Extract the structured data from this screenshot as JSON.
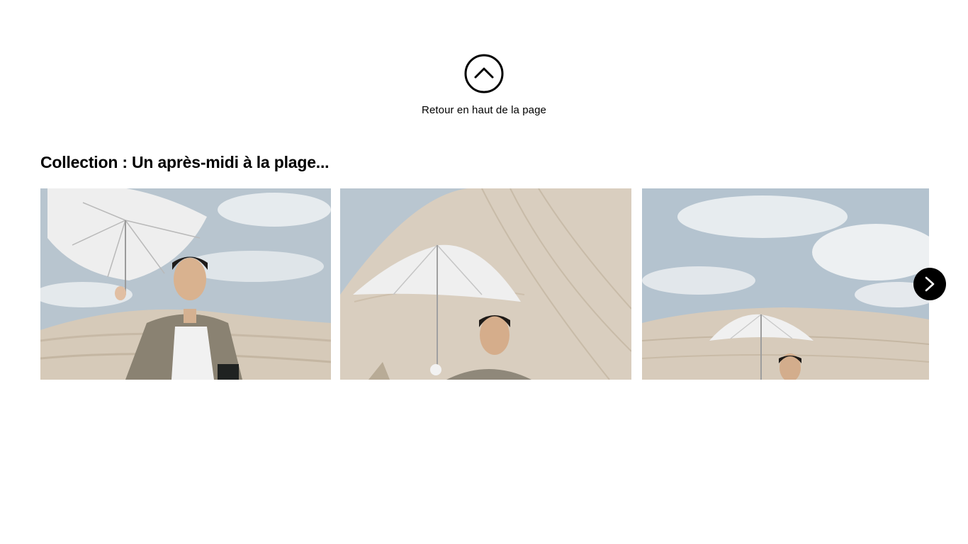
{
  "back_to_top": {
    "label": "Retour en haut de la page",
    "icon": "chevron-up-circle-icon"
  },
  "collection": {
    "title": "Collection : Un après-midi à la plage...",
    "slides": [
      {
        "image": "man-holding-umbrella-on-sand-dune-photo"
      },
      {
        "image": "man-with-umbrella-in-front-of-dune-photo"
      },
      {
        "image": "man-with-umbrella-behind-dune-photo"
      }
    ],
    "next_icon": "chevron-right-icon"
  },
  "colors": {
    "background": "#ffffff",
    "text": "#000000",
    "sky": "#b9c6d0",
    "sand": "#d7cbbb",
    "next_button": "#000000"
  }
}
